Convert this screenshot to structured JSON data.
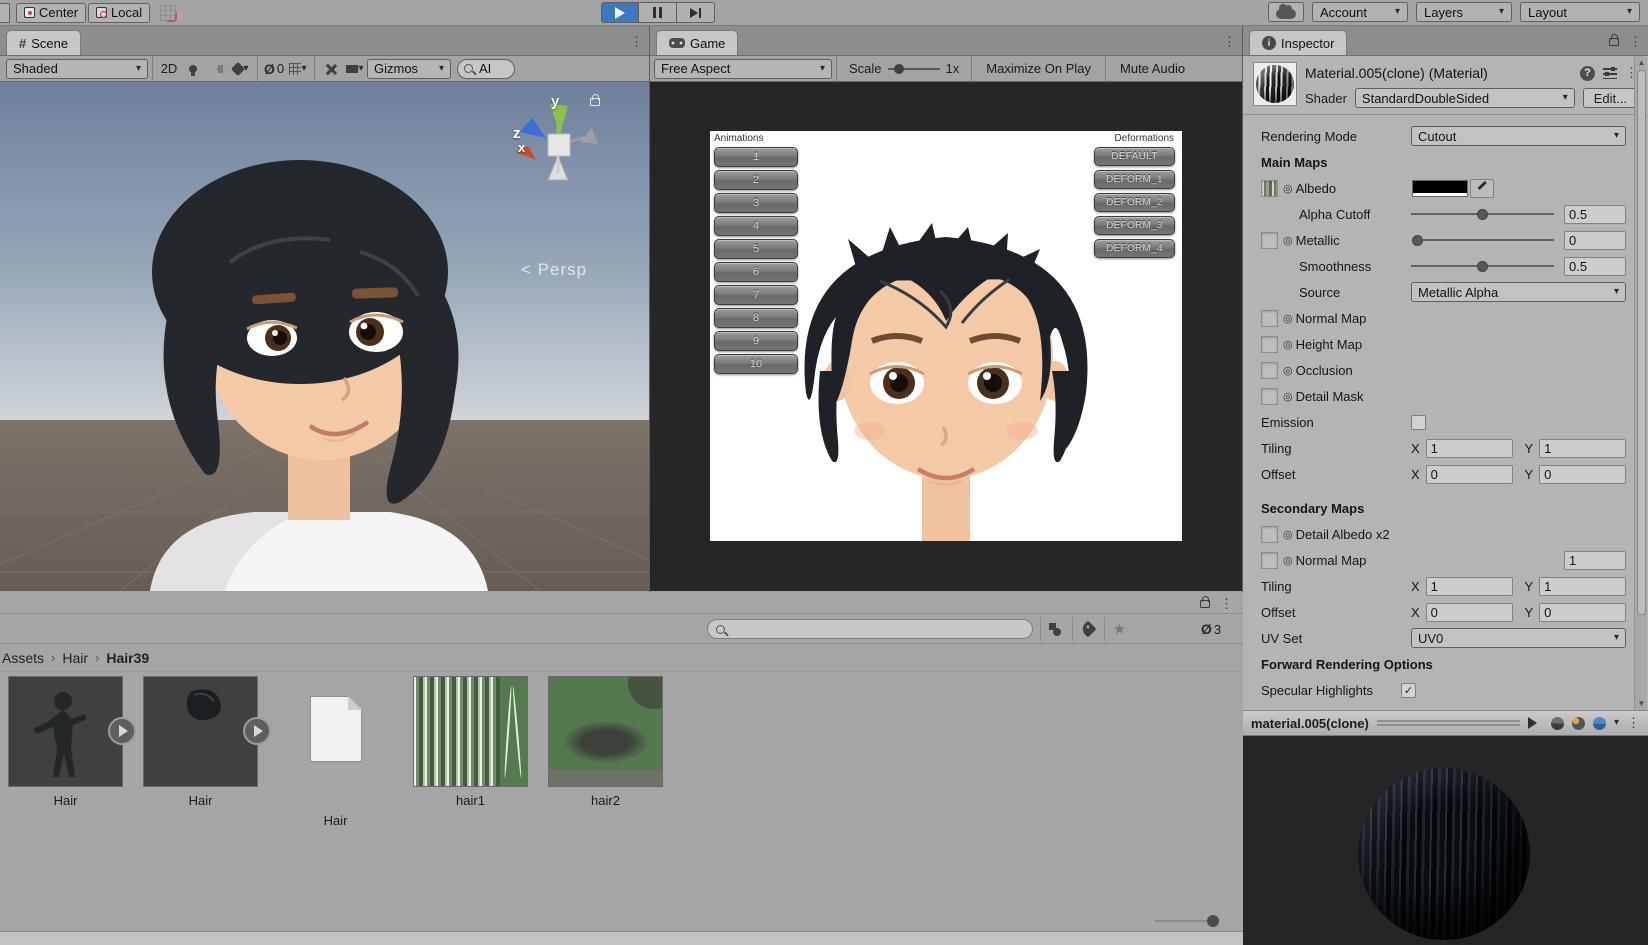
{
  "icons": {
    "caret": "▾",
    "menu": "⋮",
    "target": "◎",
    "star": "★",
    "check": "✓",
    "hash": "#",
    "info": "i",
    "help": "?",
    "eye_hidden": "Ø",
    "breadcrumb_sep": "›",
    "persp_arrow": "<",
    "scroll_up": "▲",
    "scroll_down": "▼"
  },
  "topbar": {
    "center": "Center",
    "local": "Local",
    "account": "Account",
    "layers": "Layers",
    "layout": "Layout"
  },
  "scene": {
    "tab": "Scene",
    "shading_mode": "Shaded",
    "mode_2d": "2D",
    "hidden_count": "0",
    "gizmos": "Gizmos",
    "search_value": "AI",
    "persp": "Persp",
    "axes": {
      "x": "x",
      "y": "y",
      "z": "z"
    }
  },
  "game": {
    "tab": "Game",
    "aspect": "Free Aspect",
    "scale_label": "Scale",
    "scale_value": "1x",
    "maximize": "Maximize On Play",
    "mute": "Mute Audio",
    "animations_label": "Animations",
    "animation_buttons": [
      "1",
      "2",
      "3",
      "4",
      "5",
      "6",
      "7",
      "8",
      "9",
      "10"
    ],
    "deformations_label": "Deformations",
    "deformation_buttons": [
      "DEFAULT",
      "DEFORM_1",
      "DEFORM_2",
      "DEFORM_3",
      "DEFORM_4"
    ]
  },
  "inspector": {
    "tab": "Inspector",
    "title": "Material.005(clone) (Material)",
    "shader_label": "Shader",
    "shader_value": "StandardDoubleSided",
    "edit": "Edit...",
    "rendering_mode_label": "Rendering Mode",
    "rendering_mode_value": "Cutout",
    "main_maps_header": "Main Maps",
    "albedo": "Albedo",
    "alpha_cutoff_label": "Alpha Cutoff",
    "alpha_cutoff_value": "0.5",
    "metallic_label": "Metallic",
    "metallic_value": "0",
    "smoothness_label": "Smoothness",
    "smoothness_value": "0.5",
    "source_label": "Source",
    "source_value": "Metallic Alpha",
    "normal_map": "Normal Map",
    "height_map": "Height Map",
    "occlusion": "Occlusion",
    "detail_mask": "Detail Mask",
    "emission": "Emission",
    "tiling_label": "Tiling",
    "offset_label": "Offset",
    "x_label": "X",
    "y_label": "Y",
    "tiling_x": "1",
    "tiling_y": "1",
    "offset_x": "0",
    "offset_y": "0",
    "secondary_maps_header": "Secondary Maps",
    "detail_albedo": "Detail Albedo x2",
    "secondary_normal_map": "Normal Map",
    "secondary_normal_value": "1",
    "tiling2_x": "1",
    "tiling2_y": "1",
    "offset2_x": "0",
    "offset2_y": "0",
    "uv_set_label": "UV Set",
    "uv_set_value": "UV0",
    "forward_header": "Forward Rendering Options",
    "specular_label": "Specular Highlights",
    "preview_title": "material.005(clone)"
  },
  "project": {
    "breadcrumb": [
      "Assets",
      "Hair",
      "Hair39"
    ],
    "hidden_count": "3",
    "assets": [
      {
        "label": "Hair",
        "kind": "model-figure"
      },
      {
        "label": "Hair",
        "kind": "model-hair"
      },
      {
        "label": "Hair",
        "kind": "document"
      },
      {
        "label": "hair1",
        "kind": "texture-streaks"
      },
      {
        "label": "hair2",
        "kind": "texture-patch"
      }
    ]
  },
  "colors": {
    "play_active": "#3c78bc",
    "panel_gray": "#a3a3a3",
    "inspector_bg": "#b4b4b4",
    "game_bg": "#262626",
    "texture_green": "#567a50",
    "albedo_swatch": "#000000",
    "preview_bg": "#252525"
  }
}
